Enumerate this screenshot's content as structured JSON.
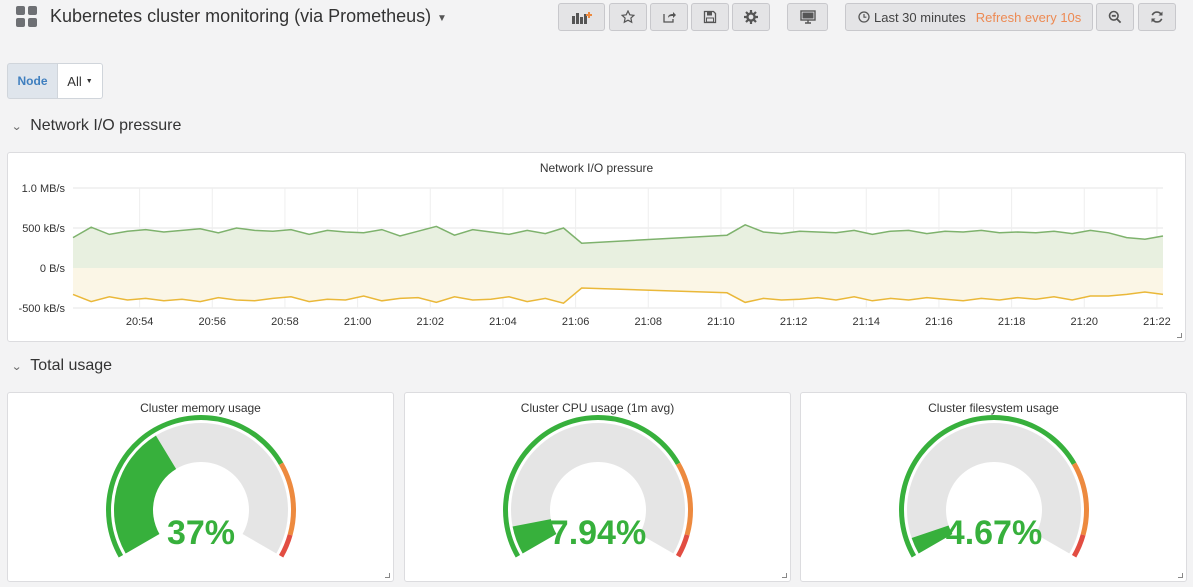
{
  "header": {
    "title": "Kubernetes cluster monitoring (via Prometheus)",
    "time_range": "Last 30 minutes",
    "refresh": "Refresh every 10s",
    "buttons": [
      "add-panel-icon",
      "star-icon",
      "share-icon",
      "save-icon",
      "gear-icon",
      "tv-icon",
      "clock-icon",
      "zoom-out-icon",
      "refresh-icon"
    ]
  },
  "variables": {
    "node_label": "Node",
    "node_value": "All"
  },
  "rows": [
    {
      "title": "Network I/O pressure"
    },
    {
      "title": "Total usage"
    }
  ],
  "network_panel": {
    "title": "Network I/O pressure"
  },
  "chart_data": {
    "type": "line",
    "title": "Network I/O pressure",
    "y_tick_labels": [
      "1.0 MB/s",
      "500 kB/s",
      "0 B/s",
      "-500 kB/s"
    ],
    "ylim": [
      -500,
      1000
    ],
    "y_unit": "kB/s",
    "x_tick_labels": [
      "20:54",
      "20:56",
      "20:58",
      "21:00",
      "21:02",
      "21:04",
      "21:06",
      "21:08",
      "21:10",
      "21:12",
      "21:14",
      "21:16",
      "21:18",
      "21:20",
      "21:22"
    ],
    "grid": true,
    "series": [
      {
        "color": "#7eb26d",
        "fill": "#e8f0e0",
        "x": [
          "20:52:10",
          "20:52:40",
          "20:53:10",
          "20:53:40",
          "20:54:10",
          "20:54:40",
          "20:55:10",
          "20:55:40",
          "20:56:10",
          "20:56:40",
          "20:57:10",
          "20:57:40",
          "20:58:10",
          "20:58:40",
          "20:59:10",
          "20:59:40",
          "21:00:10",
          "21:00:40",
          "21:01:10",
          "21:01:40",
          "21:02:10",
          "21:02:40",
          "21:03:10",
          "21:03:40",
          "21:04:10",
          "21:04:40",
          "21:05:10",
          "21:05:40",
          "21:06:10",
          "21:10:10",
          "21:10:40",
          "21:11:10",
          "21:11:40",
          "21:12:10",
          "21:12:40",
          "21:13:10",
          "21:13:40",
          "21:14:10",
          "21:14:40",
          "21:15:10",
          "21:15:40",
          "21:16:10",
          "21:16:40",
          "21:17:10",
          "21:17:40",
          "21:18:10",
          "21:18:40",
          "21:19:10",
          "21:19:40",
          "21:20:10",
          "21:20:40",
          "21:21:10",
          "21:21:40",
          "21:22:10"
        ],
        "values": [
          380,
          510,
          420,
          460,
          480,
          450,
          470,
          490,
          440,
          500,
          470,
          460,
          480,
          420,
          470,
          450,
          440,
          480,
          400,
          460,
          520,
          410,
          480,
          450,
          420,
          470,
          430,
          500,
          310,
          410,
          540,
          450,
          430,
          460,
          450,
          440,
          470,
          420,
          460,
          470,
          430,
          460,
          450,
          470,
          440,
          450,
          440,
          460,
          430,
          470,
          440,
          380,
          360,
          400
        ]
      },
      {
        "color": "#eab839",
        "fill": "#fbf6e6",
        "x": [
          "20:52:10",
          "20:52:40",
          "20:53:10",
          "20:53:40",
          "20:54:10",
          "20:54:40",
          "20:55:10",
          "20:55:40",
          "20:56:10",
          "20:56:40",
          "20:57:10",
          "20:57:40",
          "20:58:10",
          "20:58:40",
          "20:59:10",
          "20:59:40",
          "21:00:10",
          "21:00:40",
          "21:01:10",
          "21:01:40",
          "21:02:10",
          "21:02:40",
          "21:03:10",
          "21:03:40",
          "21:04:10",
          "21:04:40",
          "21:05:10",
          "21:05:40",
          "21:06:10",
          "21:10:10",
          "21:10:40",
          "21:11:10",
          "21:11:40",
          "21:12:10",
          "21:12:40",
          "21:13:10",
          "21:13:40",
          "21:14:10",
          "21:14:40",
          "21:15:10",
          "21:15:40",
          "21:16:10",
          "21:16:40",
          "21:17:10",
          "21:17:40",
          "21:18:10",
          "21:18:40",
          "21:19:10",
          "21:19:40",
          "21:20:10",
          "21:20:40",
          "21:21:10",
          "21:21:40",
          "21:22:10"
        ],
        "values": [
          -330,
          -420,
          -360,
          -400,
          -380,
          -410,
          -390,
          -420,
          -370,
          -400,
          -410,
          -380,
          -360,
          -420,
          -390,
          -400,
          -350,
          -410,
          -380,
          -370,
          -430,
          -360,
          -400,
          -390,
          -360,
          -420,
          -380,
          -440,
          -250,
          -310,
          -430,
          -380,
          -400,
          -390,
          -370,
          -400,
          -360,
          -410,
          -380,
          -400,
          -370,
          -390,
          -410,
          -380,
          -400,
          -370,
          -390,
          -360,
          -400,
          -350,
          -350,
          -330,
          -300,
          -330
        ]
      }
    ]
  },
  "gauges": [
    {
      "title": "Cluster memory usage",
      "value": 37,
      "display": "37%"
    },
    {
      "title": "Cluster CPU usage (1m avg)",
      "value": 7.94,
      "display": "7.94%"
    },
    {
      "title": "Cluster filesystem usage",
      "value": 4.67,
      "display": "4.67%"
    }
  ],
  "colors": {
    "ok": "#37b03c",
    "warn": "#ed8a3f",
    "crit": "#e24d42",
    "empty": "#e5e5e5",
    "refresh": "#ed8a53",
    "link": "#3f7fbf"
  }
}
